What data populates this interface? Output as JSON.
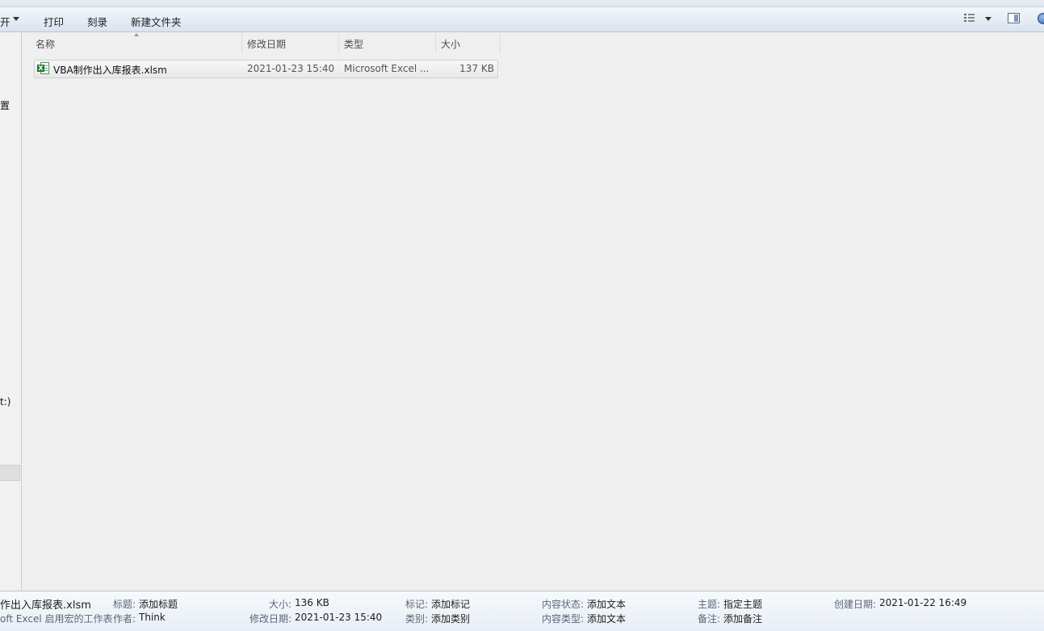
{
  "toolbar": {
    "open_label": "开",
    "print_label": "打印",
    "burn_label": "刻录",
    "new_folder_label": "新建文件夹"
  },
  "nav": {
    "partial_text_1": "置",
    "partial_text_2": "t:)"
  },
  "columns": {
    "name": "名称",
    "date": "修改日期",
    "type": "类型",
    "size": "大小"
  },
  "files": [
    {
      "name": "VBA制作出入库报表.xlsm",
      "date": "2021-01-23 15:40",
      "type": "Microsoft Excel ...",
      "size": "137 KB",
      "icon": "excel-macro-file-icon"
    }
  ],
  "details": {
    "file_name": "作出入库报表.xlsm",
    "file_type": "oft Excel 启用宏的工作表",
    "title_label": "标题:",
    "title_value": "添加标题",
    "author_label": "作者:",
    "author_value": "Think",
    "size_label": "大小:",
    "size_value": "136 KB",
    "modified_label": "修改日期:",
    "modified_value": "2021-01-23 15:40",
    "tags_label": "标记:",
    "tags_value": "添加标记",
    "category_label": "类别:",
    "category_value": "添加类别",
    "content_status_label": "内容状态:",
    "content_status_value": "添加文本",
    "content_type_label": "内容类型:",
    "content_type_value": "添加文本",
    "subject_label": "主题:",
    "subject_value": "指定主题",
    "comments_label": "备注:",
    "comments_value": "添加备注",
    "created_label": "创建日期:",
    "created_value": "2021-01-22 16:49"
  }
}
